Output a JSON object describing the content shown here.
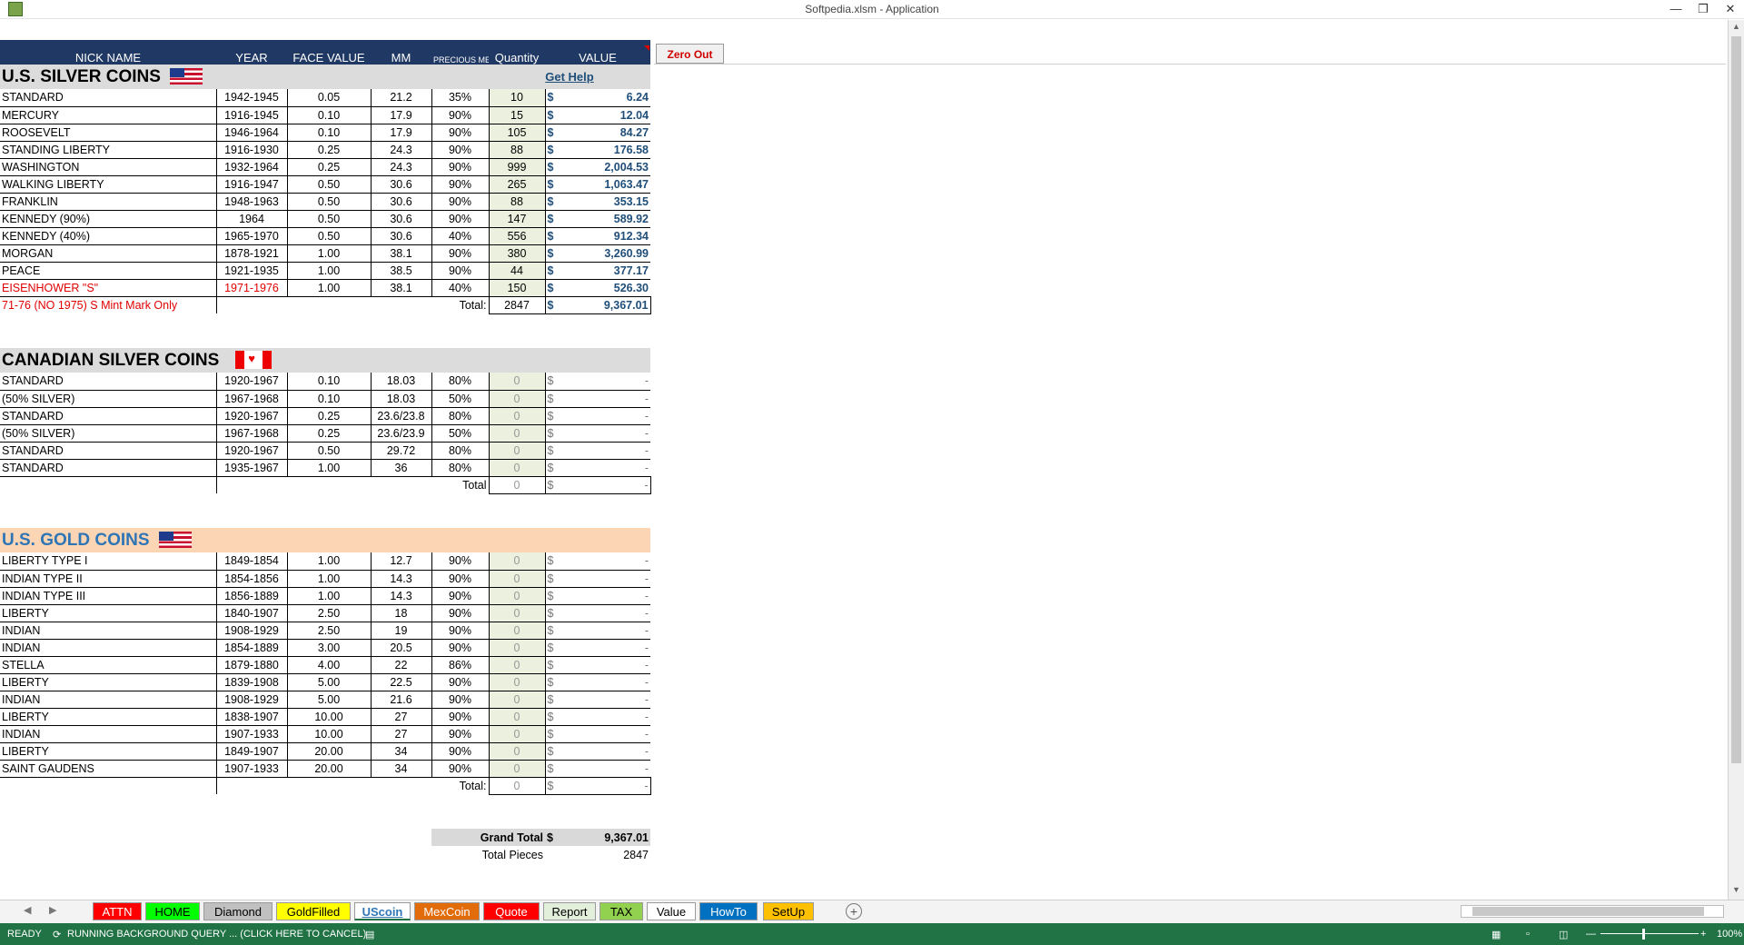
{
  "window": {
    "title": "Softpedia.xlsm - Application"
  },
  "toolbar": {
    "zero_out": "Zero Out",
    "get_help": "Get Help"
  },
  "header": {
    "nick": "NICK NAME",
    "year": "YEAR",
    "face": "FACE VALUE",
    "mm": "MM",
    "pm": "PRECIOUS METAL",
    "qty": "Quantity",
    "value": "VALUE"
  },
  "us_silver": {
    "title": "U.S. SILVER COINS",
    "rows": [
      {
        "name": "STANDARD",
        "year": "1942-1945",
        "face": "0.05",
        "mm": "21.2",
        "pm": "35%",
        "qty": "10",
        "value": "6.24"
      },
      {
        "name": "MERCURY",
        "year": "1916-1945",
        "face": "0.10",
        "mm": "17.9",
        "pm": "90%",
        "qty": "15",
        "value": "12.04"
      },
      {
        "name": "ROOSEVELT",
        "year": "1946-1964",
        "face": "0.10",
        "mm": "17.9",
        "pm": "90%",
        "qty": "105",
        "value": "84.27"
      },
      {
        "name": "STANDING LIBERTY",
        "year": "1916-1930",
        "face": "0.25",
        "mm": "24.3",
        "pm": "90%",
        "qty": "88",
        "value": "176.58"
      },
      {
        "name": "WASHINGTON",
        "year": "1932-1964",
        "face": "0.25",
        "mm": "24.3",
        "pm": "90%",
        "qty": "999",
        "value": "2,004.53"
      },
      {
        "name": "WALKING LIBERTY",
        "year": "1916-1947",
        "face": "0.50",
        "mm": "30.6",
        "pm": "90%",
        "qty": "265",
        "value": "1,063.47"
      },
      {
        "name": "FRANKLIN",
        "year": "1948-1963",
        "face": "0.50",
        "mm": "30.6",
        "pm": "90%",
        "qty": "88",
        "value": "353.15"
      },
      {
        "name": "KENNEDY (90%)",
        "year": "1964",
        "face": "0.50",
        "mm": "30.6",
        "pm": "90%",
        "qty": "147",
        "value": "589.92"
      },
      {
        "name": "KENNEDY (40%)",
        "year": "1965-1970",
        "face": "0.50",
        "mm": "30.6",
        "pm": "40%",
        "qty": "556",
        "value": "912.34"
      },
      {
        "name": "MORGAN",
        "year": "1878-1921",
        "face": "1.00",
        "mm": "38.1",
        "pm": "90%",
        "qty": "380",
        "value": "3,260.99"
      },
      {
        "name": "PEACE",
        "year": "1921-1935",
        "face": "1.00",
        "mm": "38.5",
        "pm": "90%",
        "qty": "44",
        "value": "377.17"
      },
      {
        "name": "EISENHOWER \"S\"",
        "year": "1971-1976",
        "face": "1.00",
        "mm": "38.1",
        "pm": "40%",
        "qty": "150",
        "value": "526.30"
      }
    ],
    "note": "71-76 (NO 1975) S Mint Mark Only",
    "total_label": "Total:",
    "total_qty": "2847",
    "total_value": "9,367.01"
  },
  "canadian": {
    "title": "CANADIAN SILVER COINS",
    "rows": [
      {
        "name": "STANDARD",
        "year": "1920-1967",
        "face": "0.10",
        "mm": "18.03",
        "pm": "80%",
        "qty": "0",
        "value": "-"
      },
      {
        "name": "(50% SILVER)",
        "year": "1967-1968",
        "face": "0.10",
        "mm": "18.03",
        "pm": "50%",
        "qty": "0",
        "value": "-"
      },
      {
        "name": "STANDARD",
        "year": "1920-1967",
        "face": "0.25",
        "mm": "23.6/23.8",
        "pm": "80%",
        "qty": "0",
        "value": "-"
      },
      {
        "name": "(50% SILVER)",
        "year": "1967-1968",
        "face": "0.25",
        "mm": "23.6/23.9",
        "pm": "50%",
        "qty": "0",
        "value": "-"
      },
      {
        "name": "STANDARD",
        "year": "1920-1967",
        "face": "0.50",
        "mm": "29.72",
        "pm": "80%",
        "qty": "0",
        "value": "-"
      },
      {
        "name": "STANDARD",
        "year": "1935-1967",
        "face": "1.00",
        "mm": "36",
        "pm": "80%",
        "qty": "0",
        "value": "-"
      }
    ],
    "total_label": "Total",
    "total_qty": "0",
    "total_value": "-"
  },
  "us_gold": {
    "title": "U.S. GOLD COINS",
    "rows": [
      {
        "name": "LIBERTY TYPE I",
        "year": "1849-1854",
        "face": "1.00",
        "mm": "12.7",
        "pm": "90%",
        "qty": "0",
        "value": "-"
      },
      {
        "name": "INDIAN TYPE II",
        "year": "1854-1856",
        "face": "1.00",
        "mm": "14.3",
        "pm": "90%",
        "qty": "0",
        "value": "-"
      },
      {
        "name": "INDIAN TYPE III",
        "year": "1856-1889",
        "face": "1.00",
        "mm": "14.3",
        "pm": "90%",
        "qty": "0",
        "value": "-"
      },
      {
        "name": "LIBERTY",
        "year": "1840-1907",
        "face": "2.50",
        "mm": "18",
        "pm": "90%",
        "qty": "0",
        "value": "-"
      },
      {
        "name": "INDIAN",
        "year": "1908-1929",
        "face": "2.50",
        "mm": "19",
        "pm": "90%",
        "qty": "0",
        "value": "-"
      },
      {
        "name": "INDIAN",
        "year": "1854-1889",
        "face": "3.00",
        "mm": "20.5",
        "pm": "90%",
        "qty": "0",
        "value": "-"
      },
      {
        "name": "STELLA",
        "year": "1879-1880",
        "face": "4.00",
        "mm": "22",
        "pm": "86%",
        "qty": "0",
        "value": "-"
      },
      {
        "name": "LIBERTY",
        "year": "1839-1908",
        "face": "5.00",
        "mm": "22.5",
        "pm": "90%",
        "qty": "0",
        "value": "-"
      },
      {
        "name": "INDIAN",
        "year": "1908-1929",
        "face": "5.00",
        "mm": "21.6",
        "pm": "90%",
        "qty": "0",
        "value": "-"
      },
      {
        "name": "LIBERTY",
        "year": "1838-1907",
        "face": "10.00",
        "mm": "27",
        "pm": "90%",
        "qty": "0",
        "value": "-"
      },
      {
        "name": "INDIAN",
        "year": "1907-1933",
        "face": "10.00",
        "mm": "27",
        "pm": "90%",
        "qty": "0",
        "value": "-"
      },
      {
        "name": "LIBERTY",
        "year": "1849-1907",
        "face": "20.00",
        "mm": "34",
        "pm": "90%",
        "qty": "0",
        "value": "-"
      },
      {
        "name": "SAINT GAUDENS",
        "year": "1907-1933",
        "face": "20.00",
        "mm": "34",
        "pm": "90%",
        "qty": "0",
        "value": "-"
      }
    ],
    "total_label": "Total:",
    "total_qty": "0",
    "total_value": "-"
  },
  "summary": {
    "grand_total_label": "Grand Total",
    "grand_total_value": "9,367.01",
    "total_pieces_label": "Total Pieces",
    "total_pieces_value": "2847"
  },
  "currency": "$",
  "tabs": [
    {
      "label": "ATTN",
      "color": "#ff0000",
      "text": "#ffffff"
    },
    {
      "label": "HOME",
      "color": "#00ff00",
      "text": "#000000"
    },
    {
      "label": "Diamond",
      "color": "#c0c0c0",
      "text": "#000000"
    },
    {
      "label": "GoldFilled",
      "color": "#ffff00",
      "text": "#000000"
    },
    {
      "label": "UScoin",
      "color": "#ffffff",
      "text": "#2e75b6"
    },
    {
      "label": "MexCoin",
      "color": "#e26b0a",
      "text": "#ffffff"
    },
    {
      "label": "Quote",
      "color": "#ff0000",
      "text": "#ffffff"
    },
    {
      "label": "Report",
      "color": "#e2efda",
      "text": "#000000"
    },
    {
      "label": "TAX",
      "color": "#92d050",
      "text": "#000000"
    },
    {
      "label": "Value",
      "color": "#ffffff",
      "text": "#000000"
    },
    {
      "label": "HowTo",
      "color": "#0070c0",
      "text": "#ffffff"
    },
    {
      "label": "SetUp",
      "color": "#ffc000",
      "text": "#000000"
    }
  ],
  "statusbar": {
    "ready": "READY",
    "query": "RUNNING BACKGROUND QUERY ... (CLICK HERE TO CANCEL)",
    "zoom": "100%"
  }
}
